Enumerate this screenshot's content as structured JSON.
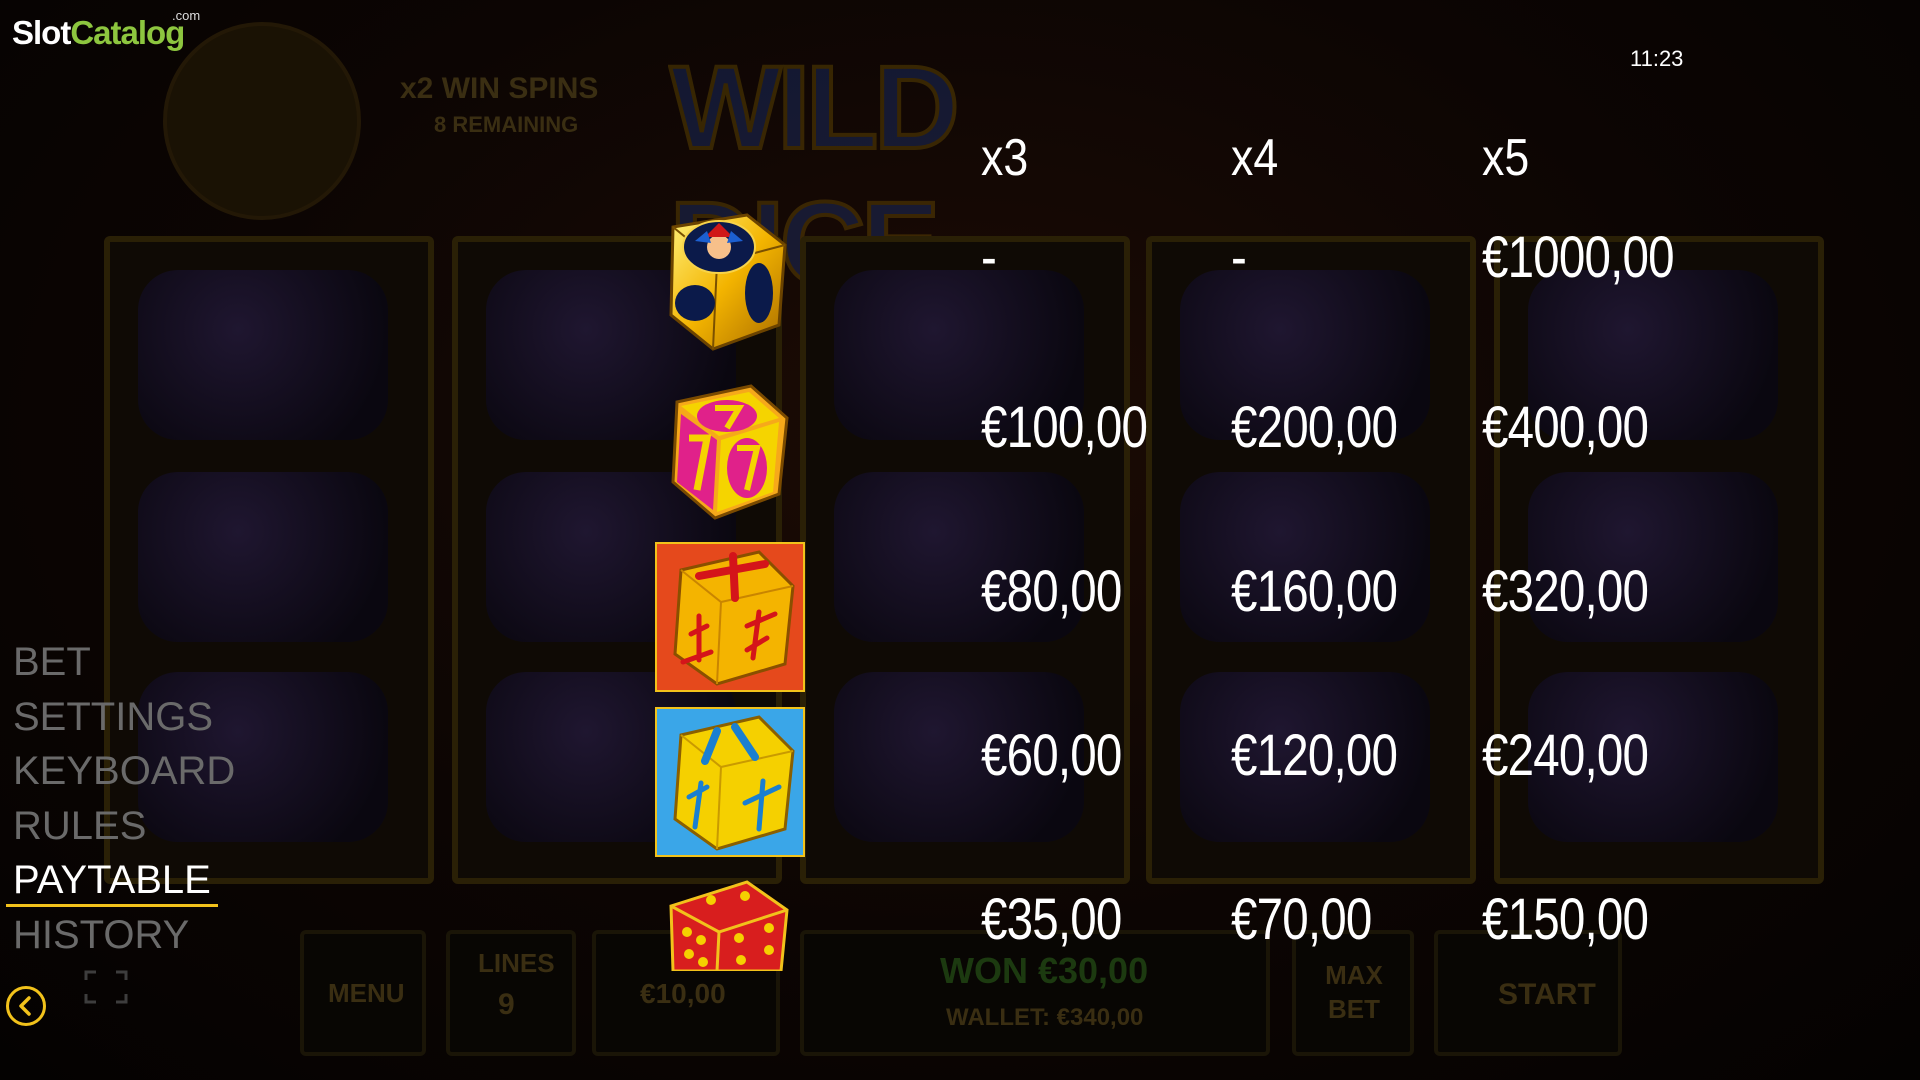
{
  "brand": {
    "slot": "Slot",
    "catalog": "Catalog",
    "com": ".com"
  },
  "clock": "11:23",
  "menu": {
    "items": [
      "BET",
      "SETTINGS",
      "KEYBOARD",
      "RULES",
      "PAYTABLE",
      "HISTORY"
    ],
    "active": "PAYTABLE"
  },
  "paytable": {
    "columns": [
      "x3",
      "x4",
      "x5"
    ],
    "rows": [
      {
        "symbol": "jester-die-icon",
        "payouts": [
          "-",
          "-",
          "€1000,00"
        ]
      },
      {
        "symbol": "seven-die-icon",
        "payouts": [
          "€100,00",
          "€200,00",
          "€400,00"
        ]
      },
      {
        "symbol": "orange-chinese-die-icon",
        "payouts": [
          "€80,00",
          "€160,00",
          "€320,00"
        ]
      },
      {
        "symbol": "blue-chinese-die-icon",
        "payouts": [
          "€60,00",
          "€120,00",
          "€240,00"
        ]
      },
      {
        "symbol": "red-six-die-icon",
        "payouts": [
          "€35,00",
          "€70,00",
          "€150,00"
        ]
      }
    ]
  },
  "background": {
    "logo": "WILD DICE",
    "win_spins": "x2 WIN SPINS",
    "remaining": "8 REMAINING",
    "menu_button": "MENU",
    "lines_label": "LINES",
    "lines_value": "9",
    "bet_value": "€10,00",
    "won": "WON €30,00",
    "wallet": "WALLET: €340,00",
    "max_bet": "MAX BET",
    "start": "START"
  },
  "colors": {
    "accent": "#f2c21b",
    "menu_inactive": "#6a6a6a",
    "brand_green": "#8dc63f"
  }
}
